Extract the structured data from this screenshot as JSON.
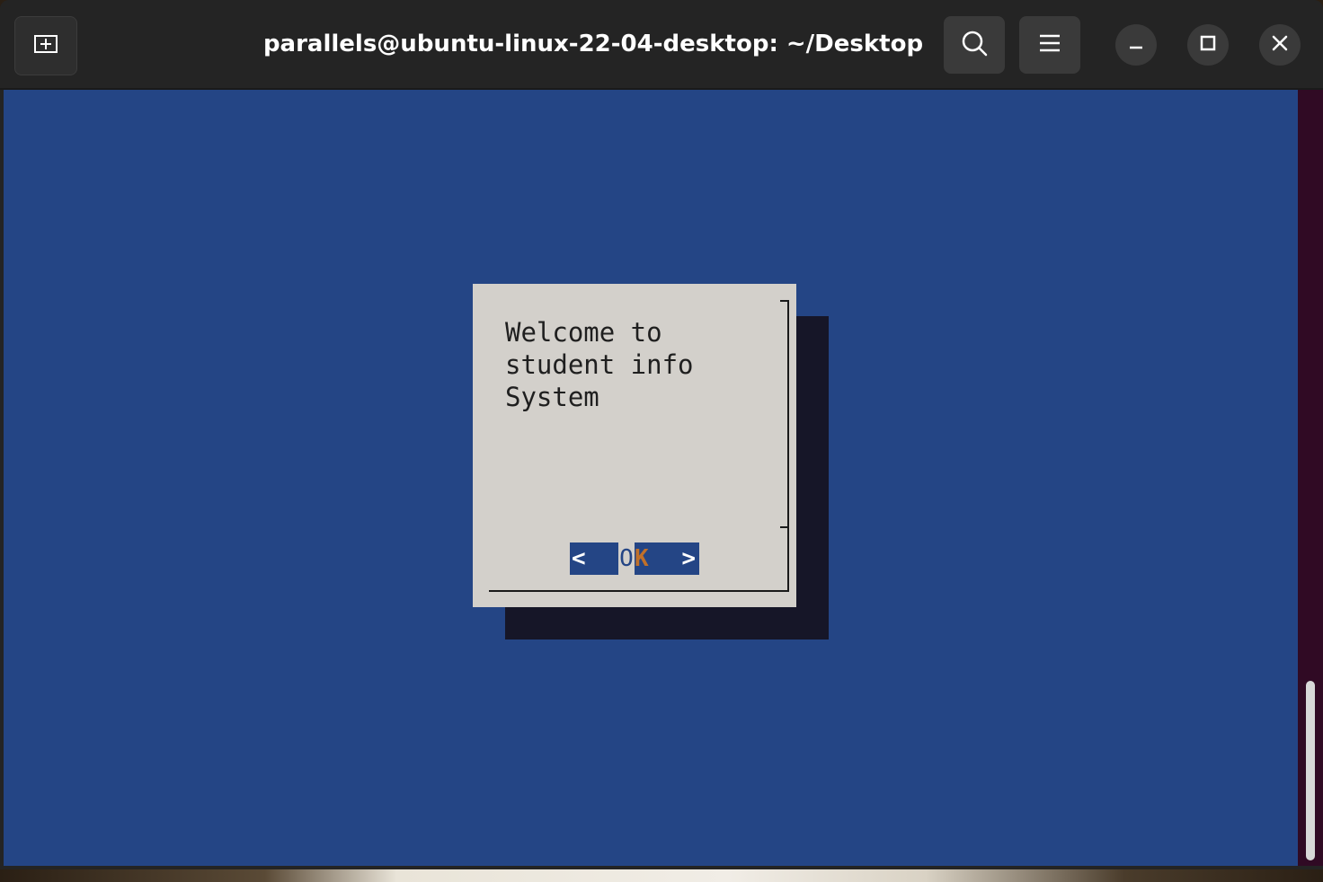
{
  "window": {
    "title": "parallels@ubuntu-linux-22-04-desktop: ~/Desktop"
  },
  "dialog": {
    "message": "Welcome to\nstudent info\nSystem",
    "button": {
      "left": "<",
      "first_letter": "O",
      "hotkey_letter": "K",
      "right": ">"
    }
  },
  "colors": {
    "terminal_background": "#244585",
    "dialog_background": "#d3d0cb",
    "dialog_shadow": "#161628",
    "titlebar": "#242424",
    "hotkey": "#c0702a"
  },
  "icons": {
    "new_tab": "new-tab-icon",
    "search": "search-icon",
    "menu": "hamburger-menu-icon",
    "minimize": "minimize-icon",
    "maximize": "maximize-icon",
    "close": "close-icon"
  }
}
